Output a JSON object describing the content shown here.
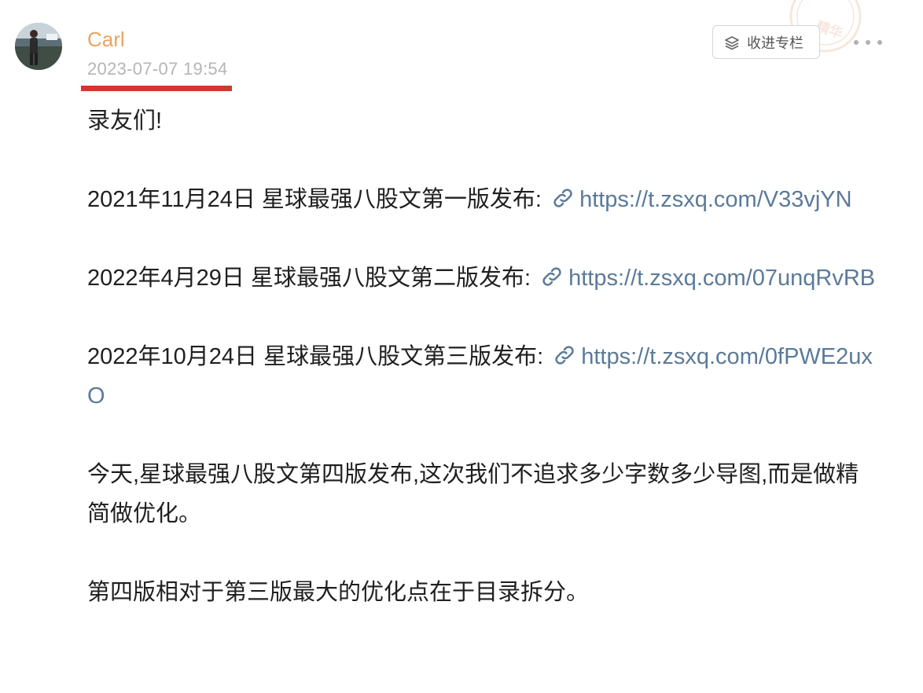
{
  "post": {
    "author": "Carl",
    "time": "2023-07-07 19:54",
    "more_label": "···",
    "stamp_text": "精华",
    "column_button_label": "收进专栏",
    "intro": "录友们!",
    "releases": [
      {
        "text": "2021年11月24日 星球最强八股文第一版发布:",
        "url": "https://t.zsxq.com/V33vjYN"
      },
      {
        "text": "2022年4月29日 星球最强八股文第二版发布:",
        "url": "https://t.zsxq.com/07unqRvRB"
      },
      {
        "text": "2022年10月24日 星球最强八股文第三版发布:",
        "url": "https://t.zsxq.com/0fPWE2uxO"
      }
    ],
    "paragraph_today": "今天,星球最强八股文第四版发布,这次我们不追求多少字数多少导图,而是做精简做优化。",
    "paragraph_compare": "第四版相对于第三版最大的优化点在于目录拆分。"
  },
  "icons": {
    "avatar": "avatar-photo",
    "column": "stack-layers-icon",
    "link": "chain-link-icon",
    "more": "ellipsis-icon",
    "stamp": "essence-stamp-icon"
  },
  "colors": {
    "author": "#e9a35f",
    "time": "#b5b5b5",
    "link": "#5b7a99",
    "underline": "#cf3a2c",
    "stamp": "#e8b9a0"
  }
}
